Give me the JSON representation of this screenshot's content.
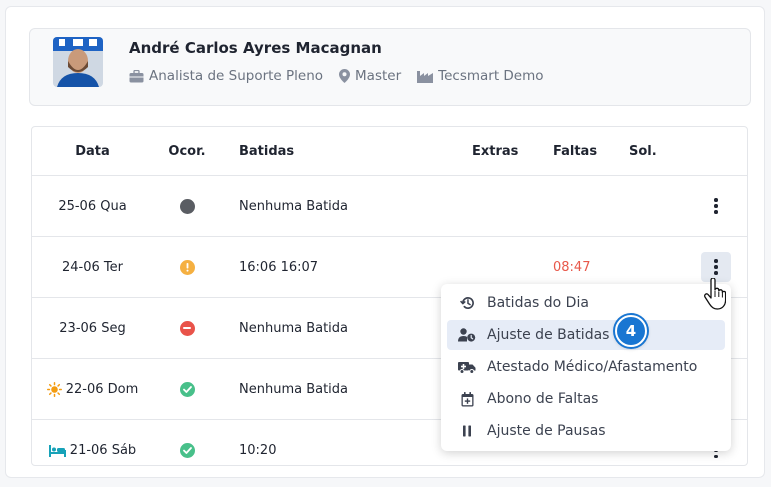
{
  "profile": {
    "name": "André Carlos Ayres Macagnan",
    "role": "Analista de Suporte Pleno",
    "location": "Master",
    "company": "Tecsmart Demo"
  },
  "table": {
    "headers": {
      "date": "Data",
      "ocor": "Ocor.",
      "batidas": "Batidas",
      "extras": "Extras",
      "faltas": "Faltas",
      "sol": "Sol."
    },
    "rows": [
      {
        "date": "25-06 Qua",
        "status": "gray",
        "batidas": "Nenhuma Batida",
        "faltas": ""
      },
      {
        "date": "24-06 Ter",
        "status": "warning",
        "batidas": "16:06 16:07",
        "faltas": "08:47"
      },
      {
        "date": "23-06 Seg",
        "status": "error",
        "batidas": "Nenhuma Batida",
        "faltas": ""
      },
      {
        "date": "22-06 Dom",
        "status": "ok",
        "batidas": "Nenhuma Batida",
        "faltas": "",
        "day_icon": "sun-icon"
      },
      {
        "date": "21-06 Sáb",
        "status": "ok",
        "batidas": "10:20",
        "faltas": "",
        "day_icon": "bed-icon"
      }
    ]
  },
  "menu": {
    "items": [
      {
        "label": "Batidas do Dia",
        "icon": "history-icon"
      },
      {
        "label": "Ajuste de Batidas",
        "icon": "user-clock-icon",
        "highlighted": true
      },
      {
        "label": "Atestado Médico/Afastamento",
        "icon": "ambulance-icon"
      },
      {
        "label": "Abono de Faltas",
        "icon": "calendar-plus-icon"
      },
      {
        "label": "Ajuste de Pausas",
        "icon": "pause-icon"
      }
    ]
  },
  "step_badge": "4",
  "colors": {
    "status_gray": "#5a5d63",
    "status_warning": "#f5b041",
    "status_error": "#e9534a",
    "status_ok": "#48c08a",
    "faltas_red": "#e8584a",
    "badge_blue": "#1976d2",
    "sun_orange": "#f39c12",
    "bed_teal": "#17a2b8"
  }
}
